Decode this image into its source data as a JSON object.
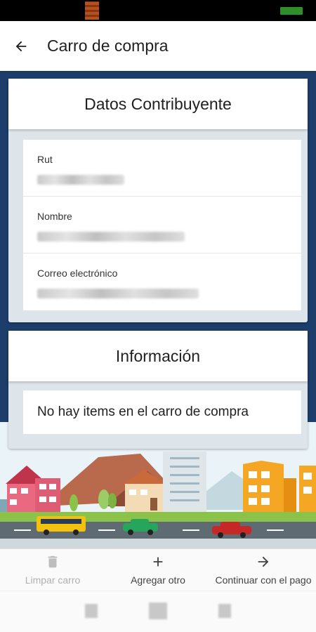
{
  "app_bar": {
    "title": "Carro de compra"
  },
  "taxpayer_card": {
    "title": "Datos Contribuyente",
    "fields": [
      {
        "label": "Rut"
      },
      {
        "label": "Nombre"
      },
      {
        "label": "Correo electrónico"
      }
    ]
  },
  "info_card": {
    "title": "Información",
    "empty_message": "No hay items en el carro de compra"
  },
  "actions": {
    "clear": {
      "label": "Limpar carro",
      "icon": "trash-icon",
      "enabled": false
    },
    "add": {
      "label": "Agregar otro",
      "icon": "plus-icon",
      "enabled": true
    },
    "continue": {
      "label": "Continuar con el pago",
      "icon": "arrow-right-icon",
      "enabled": true
    }
  },
  "colors": {
    "background": "#1d3d6a",
    "card_panel": "#dde4ea",
    "disabled_text": "#b0b0b0"
  }
}
